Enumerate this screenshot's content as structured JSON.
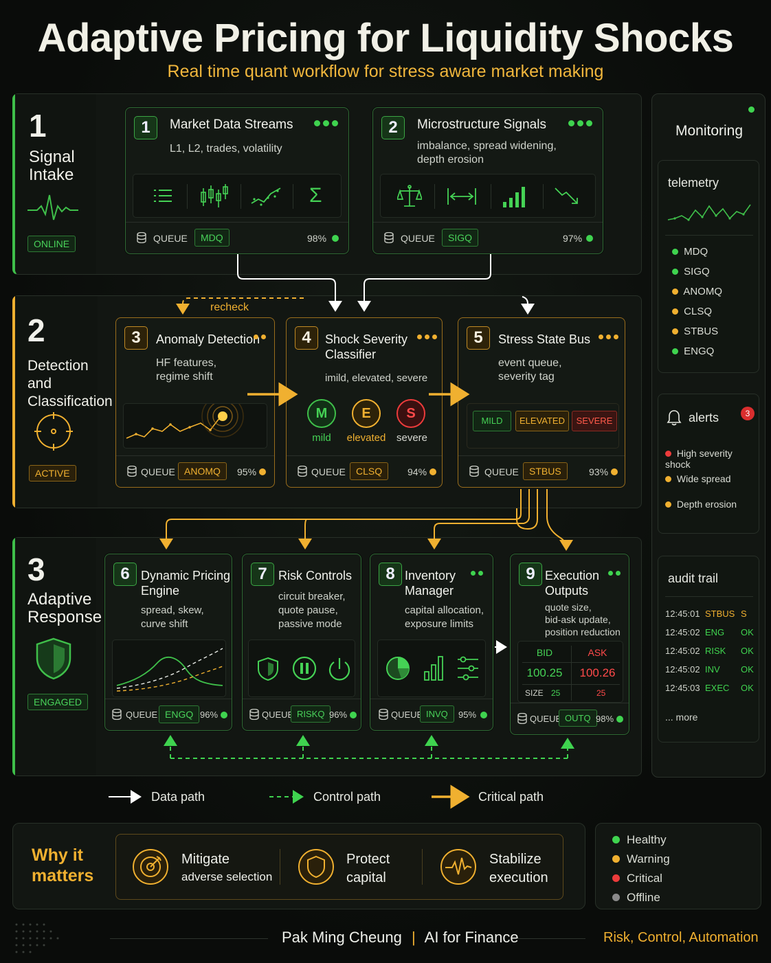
{
  "header": {
    "title": "Adaptive Pricing for Liquidity Shocks",
    "subtitle": "Real time quant workflow for stress aware market making"
  },
  "colors": {
    "healthy": "#3fd34f",
    "warning": "#f0b030",
    "critical": "#ec3b3b",
    "offline": "#8a8a8a",
    "title": "#f1f0e6",
    "accent": "#f0b63c"
  },
  "stages": [
    {
      "num": "1",
      "name_lines": [
        "Signal",
        "Intake"
      ],
      "status": "ONLINE"
    },
    {
      "num": "2",
      "name_lines": [
        "Detection",
        "and",
        "Classification"
      ],
      "status": "ACTIVE"
    },
    {
      "num": "3",
      "name_lines": [
        "Adaptive",
        "Response"
      ],
      "status": "ENGAGED"
    }
  ],
  "cards": {
    "c1": {
      "num": "1",
      "title": "Market Data Streams",
      "sub": [
        "L1, L2, trades, volatility"
      ],
      "queue_label": "QUEUE",
      "queue": "MDQ",
      "pct": "98%"
    },
    "c2": {
      "num": "2",
      "title": "Microstructure Signals",
      "sub": [
        "imbalance, spread widening,",
        "depth erosion"
      ],
      "queue_label": "QUEUE",
      "queue": "SIGQ",
      "pct": "97%"
    },
    "c3": {
      "num": "3",
      "title": "Anomaly Detection",
      "sub": [
        "HF features,",
        "regime shift"
      ],
      "queue_label": "QUEUE",
      "queue": "ANOMQ",
      "pct": "95%"
    },
    "c4": {
      "num": "4",
      "title_lines": [
        "Shock Severity",
        "Classifier"
      ],
      "sub": [
        "imild, elevated, severe"
      ],
      "queue_label": "QUEUE",
      "queue": "CLSQ",
      "pct": "94%",
      "levels": [
        {
          "letter": "M",
          "label": "mild"
        },
        {
          "letter": "E",
          "label": "elevated"
        },
        {
          "letter": "S",
          "label": "severe"
        }
      ]
    },
    "c5": {
      "num": "5",
      "title": "Stress State Bus",
      "sub": [
        "event queue,",
        "severity tag"
      ],
      "queue_label": "QUEUE",
      "queue": "STBUS",
      "pct": "93%",
      "tags": [
        "MILD",
        "ELEVATED",
        "SEVERE"
      ]
    },
    "c6": {
      "num": "6",
      "title_lines": [
        "Dynamic Pricing",
        "Engine"
      ],
      "sub": [
        "spread, skew,",
        "curve shift"
      ],
      "queue_label": "QUEUE",
      "queue": "ENGQ",
      "pct": "96%"
    },
    "c7": {
      "num": "7",
      "title": "Risk Controls",
      "sub": [
        "circuit breaker,",
        "quote pause,",
        "passive mode"
      ],
      "queue_label": "QUEUE",
      "queue": "RISKQ",
      "pct": "96%"
    },
    "c8": {
      "num": "8",
      "title_lines": [
        "Inventory",
        "Manager"
      ],
      "sub": [
        "capital allocation,",
        "exposure limits"
      ],
      "queue_label": "QUEUE",
      "queue": "INVQ",
      "pct": "95%"
    },
    "c9": {
      "num": "9",
      "title_lines": [
        "Execution",
        "Outputs"
      ],
      "sub": [
        "quote size,",
        "bid-ask update,",
        "position reduction"
      ],
      "queue_label": "QUEUE",
      "queue": "OUTQ",
      "pct": "98%",
      "quote": {
        "bid_label": "BID",
        "ask_label": "ASK",
        "bid": "100.25",
        "ask": "100.26",
        "size_label": "SIZE",
        "bid_size": "25",
        "ask_size": "25"
      }
    }
  },
  "recheck_label": "recheck",
  "monitoring": {
    "title": "Monitoring",
    "telemetry_title": "telemetry",
    "queues": [
      {
        "name": "MDQ",
        "status": "healthy"
      },
      {
        "name": "SIGQ",
        "status": "healthy"
      },
      {
        "name": "ANOMQ",
        "status": "warning"
      },
      {
        "name": "CLSQ",
        "status": "warning"
      },
      {
        "name": "STBUS",
        "status": "warning"
      },
      {
        "name": "ENGQ",
        "status": "healthy"
      }
    ],
    "alerts_title": "alerts",
    "alerts_count": "3",
    "alerts": [
      {
        "text": "High severity shock",
        "status": "critical"
      },
      {
        "text": "Wide spread",
        "status": "warning"
      },
      {
        "text": "Depth erosion",
        "status": "warning"
      }
    ],
    "audit_title": "audit trail",
    "audit": [
      {
        "time": "12:45:01",
        "src": "STBUS",
        "code": "S"
      },
      {
        "time": "12:45:02",
        "src": "ENG",
        "code": "OK"
      },
      {
        "time": "12:45:02",
        "src": "RISK",
        "code": "OK"
      },
      {
        "time": "12:45:02",
        "src": "INV",
        "code": "OK"
      },
      {
        "time": "12:45:03",
        "src": "EXEC",
        "code": "OK"
      }
    ],
    "audit_more": "... more"
  },
  "legend": {
    "data": "Data path",
    "control": "Control path",
    "critical": "Critical path"
  },
  "why": {
    "title_lines": [
      "Why it",
      "matters"
    ],
    "items": [
      {
        "l1": "Mitigate",
        "l2": "adverse selection"
      },
      {
        "l1": "Protect",
        "l2": "capital"
      },
      {
        "l1": "Stabilize",
        "l2": "execution"
      }
    ]
  },
  "status_legend": [
    "Healthy",
    "Warning",
    "Critical",
    "Offline"
  ],
  "footer": {
    "author": "Pak Ming Cheung",
    "separator": "|",
    "org": "AI for Finance",
    "tagline": "Risk, Control, Automation"
  }
}
